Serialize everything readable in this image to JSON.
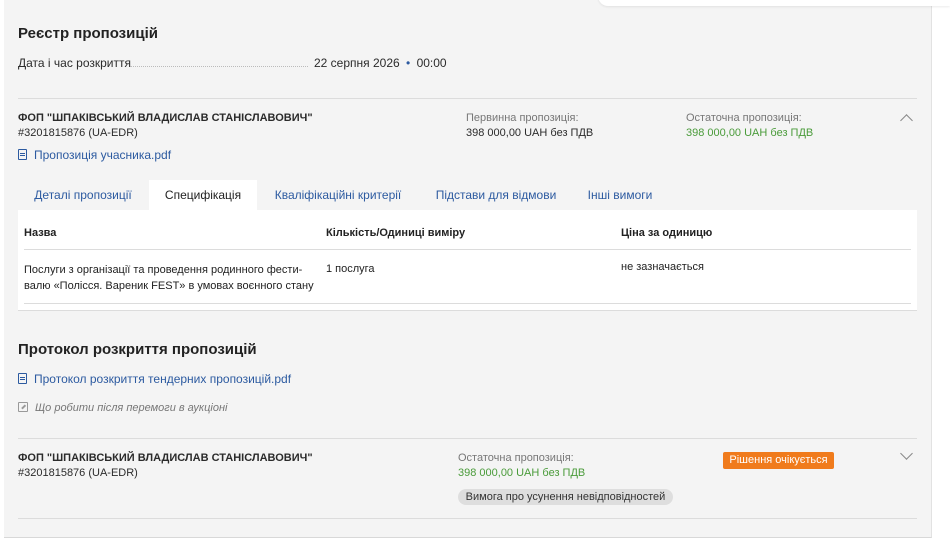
{
  "registry": {
    "title": "Реєстр пропозицій",
    "open_date_label": "Дата і час розкриття",
    "open_date_value": "22 серпня 2026",
    "open_time_value": "00:00",
    "date_sep": "•"
  },
  "bid1": {
    "bidder_name": "ФОП \"ШПАКІВСЬКИЙ ВЛАДИСЛАВ СТАНІСЛАВОВИЧ\"",
    "bidder_id": "#3201815876 (UA-EDR)",
    "initial_label": "Первинна пропозиція:",
    "initial_value": "398 000,00 UAH без ПДВ",
    "final_label": "Остаточна пропозиція:",
    "final_value": "398 000,00 UAH без ПДВ",
    "file_link": "Пропозиція учасника.pdf"
  },
  "tabs": [
    {
      "label": "Деталі пропозиції",
      "active": false
    },
    {
      "label": "Специфікація",
      "active": true
    },
    {
      "label": "Кваліфікаційні критерії",
      "active": false
    },
    {
      "label": "Підстави для відмови",
      "active": false
    },
    {
      "label": "Інші вимоги",
      "active": false
    }
  ],
  "spec_table": {
    "headers": [
      "Назва",
      "Кількість/Одиниці виміру",
      "Ціна за одиницю"
    ],
    "rows": [
      {
        "name_line1": "Послуги з організації та проведення родинного фести-",
        "name_line2": "валю «Полісся. Вареник FEST» в умовах воєнного стану",
        "quantity": "1 послуга",
        "price": "не зазначається"
      }
    ]
  },
  "protocol": {
    "title": "Протокол розкриття пропозицій",
    "file_link": "Протокол розкриття тендерних пропозицій.pdf",
    "after_win_link": "Що робити після перемоги в аукціоні"
  },
  "bid2": {
    "bidder_name": "ФОП \"ШПАКІВСЬКИЙ ВЛАДИСЛАВ СТАНІСЛАВОВИЧ\"",
    "bidder_id": "#3201815876 (UA-EDR)",
    "final_label": "Остаточна пропозиція:",
    "final_value": "398 000,00 UAH без ПДВ",
    "status_badge": "Рішення очікується",
    "requirement_badge": "Вимога про усунення невідповідностей"
  },
  "colors": {
    "accent_link": "#2c5aa0",
    "price_green": "#4a9b3a",
    "status_orange": "#f07b1c",
    "panel_bg": "#f4f4f4"
  },
  "icons": [
    "document-icon",
    "edit-note-icon",
    "chevron-up-icon",
    "chevron-down-icon"
  ]
}
